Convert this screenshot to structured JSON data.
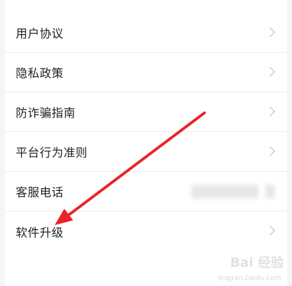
{
  "menu": {
    "items": [
      {
        "label": "用户协议"
      },
      {
        "label": "隐私政策"
      },
      {
        "label": "防诈骗指南"
      },
      {
        "label": "平台行为准则"
      },
      {
        "label": "客服电话"
      },
      {
        "label": "软件升级"
      }
    ]
  },
  "watermark": {
    "text": "Bai 经验",
    "url": "jingyan.baidu.com"
  },
  "colors": {
    "arrow": "#e8232a",
    "background": "#f5f5f5",
    "row_background": "#ffffff",
    "chevron": "#b8b8b8"
  },
  "icons": {
    "chevron": "chevron-right-icon",
    "arrow": "red-annotation-arrow"
  }
}
